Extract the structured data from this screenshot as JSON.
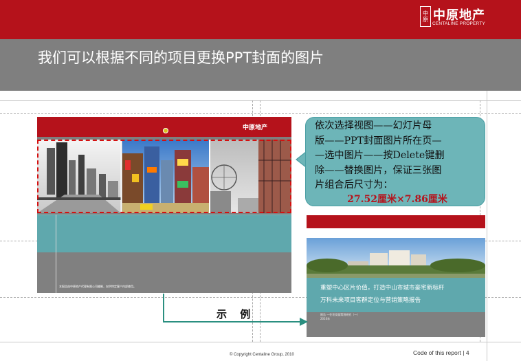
{
  "header": {
    "logo_seal": "中原",
    "logo_cn": "中原地产",
    "logo_en": "CENTALINE PROPERTY"
  },
  "slide": {
    "title": "我们可以根据不同的项目更换PPT封面的图片"
  },
  "instruction": {
    "lines": [
      "依次选择视图——幻灯片母",
      "版——PPT封面图片所在页—",
      "—选中图片——按Delete键删",
      "除——替换图片，保证三张图",
      "片组合后尺寸为："
    ],
    "size": "27.52厘米×7.86厘米"
  },
  "template_thumb": {
    "logo": "中原地产",
    "footer_text": "本报告由中原地产代理有限公司编制，仅供特定客户内部使用。"
  },
  "example_cover": {
    "line1": "重塑中心区片价值，打造中山市城市豪宅新标杆",
    "line2": "万科未来项目客群定位与营销策略报告",
    "small1": "报告 —住宅发展策划研究（一）",
    "small2": "2010年"
  },
  "example_label": "示  例",
  "footer": {
    "copyright": "© Copyright  Centaline  Group,  2010",
    "code": "Code of this report  |   4"
  },
  "colors": {
    "brand_red": "#b5121b",
    "band_gray": "#7f7f7f",
    "teal": "#5fa8ad",
    "bubble": "#6db5b8",
    "arrow": "#2a8f80"
  }
}
